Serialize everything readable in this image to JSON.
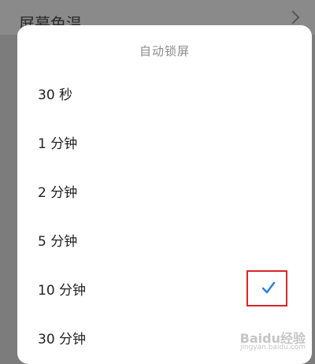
{
  "background": {
    "title": "屏幕色温"
  },
  "dialog": {
    "title": "自动锁屏",
    "options": [
      {
        "label": "30 秒",
        "selected": false
      },
      {
        "label": "1 分钟",
        "selected": false
      },
      {
        "label": "2 分钟",
        "selected": false
      },
      {
        "label": "5 分钟",
        "selected": false
      },
      {
        "label": "10 分钟",
        "selected": true
      },
      {
        "label": "30 分钟",
        "selected": false
      }
    ]
  },
  "watermark": {
    "text": "Baidu经验",
    "url": "jingyan.baidu.com"
  },
  "colors": {
    "overlay": "#7c7c7c",
    "check": "#2f7fd8",
    "highlight_box": "#d9252b"
  },
  "icons": {
    "selected": "check-icon",
    "background_row": "chevron-right-icon"
  }
}
